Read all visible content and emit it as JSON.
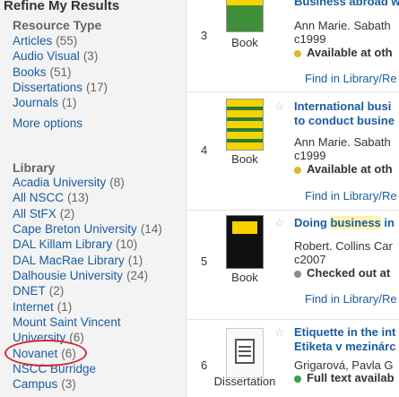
{
  "sidebar": {
    "title": "Refine My Results",
    "resource_type": {
      "heading": "Resource Type",
      "items": [
        {
          "label": "Articles",
          "count": "(55)"
        },
        {
          "label": "Audio Visual",
          "count": "(3)"
        },
        {
          "label": "Books",
          "count": "(51)"
        },
        {
          "label": "Dissertations",
          "count": "(17)"
        },
        {
          "label": "Journals",
          "count": "(1)"
        }
      ],
      "more": "More options"
    },
    "library": {
      "heading": "Library",
      "items": [
        {
          "label": "Acadia University",
          "count": "(8)"
        },
        {
          "label": "All NSCC",
          "count": "(13)"
        },
        {
          "label": "All StFX",
          "count": "(2)"
        },
        {
          "label": "Cape Breton University",
          "count": "(14)"
        },
        {
          "label": "DAL Killam Library",
          "count": "(10)"
        },
        {
          "label": "DAL MacRae Library",
          "count": "(1)"
        },
        {
          "label": "Dalhousie University",
          "count": "(24)"
        },
        {
          "label": "DNET",
          "count": "(2)"
        },
        {
          "label": "Internet",
          "count": "(1)"
        },
        {
          "label": "Mount Saint Vincent",
          "count": ""
        },
        {
          "label": "University",
          "count": "(6)"
        },
        {
          "label": "Novanet",
          "count": "(6)"
        },
        {
          "label": "NSCC Burridge",
          "count": ""
        },
        {
          "label": "Campus",
          "count": "(3)"
        }
      ]
    }
  },
  "results": [
    {
      "number": "3",
      "type": "Book",
      "title_lines": [
        "Business abroad w"
      ],
      "meta_lines": [
        "Ann Marie. Sabath",
        "c1999"
      ],
      "availability": "Available at oth",
      "availability_color": "#e3b421",
      "find_link": "Find in Library/Re"
    },
    {
      "number": "4",
      "type": "Book",
      "title_lines": [
        "International busi",
        "to conduct busine"
      ],
      "meta_lines": [
        "Ann Marie. Sabath",
        "c1999"
      ],
      "availability": "Available at oth",
      "availability_color": "#e3b421",
      "find_link": "Find in Library/Re"
    },
    {
      "number": "5",
      "type": "Book",
      "title_prefix": "Doing ",
      "title_highlight": "business",
      "title_suffix": " in",
      "meta_lines": [
        "Robert. Collins Car",
        "c2007"
      ],
      "availability": "Checked out at",
      "availability_color": "#8c8c8c",
      "find_link": "Find in Library/Re"
    },
    {
      "number": "6",
      "type": "Dissertation",
      "title_lines": [
        "Etiquette in the int",
        "Etiketa v mezinárc"
      ],
      "meta_lines": [
        "Grigarová, Pavla G"
      ],
      "availability": "Full text availab",
      "availability_color": "#3aa14a"
    }
  ],
  "colors": {
    "link": "#1a5c9e",
    "highlight": "#fff3b0",
    "annotation_circle": "#d4283a"
  }
}
